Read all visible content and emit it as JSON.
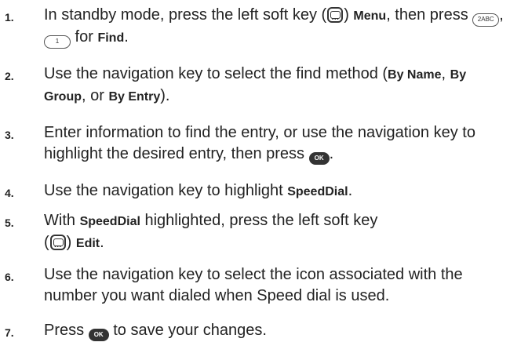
{
  "steps": [
    {
      "num": "1.",
      "t1": "In standby mode, press the left soft key (",
      "t2": ") ",
      "b1": "Menu",
      "t3": ", then press ",
      "key_a": "2ABC",
      "t4": ", ",
      "key_b": "1",
      "t5": " for ",
      "b2": "Find",
      "t6": "."
    },
    {
      "num": "2.",
      "t1": "Use the navigation key to select the find method (",
      "b1": "By Name",
      "t2": ", ",
      "b2": "By Group",
      "t3": ", or ",
      "b3": "By Entry",
      "t4": ")."
    },
    {
      "num": "3.",
      "t1": "Enter information to find the entry, or use the navigation key to highlight the desired entry, then press ",
      "ok": "OK",
      "t2": "."
    },
    {
      "num": "4.",
      "t1": "Use the navigation key to highlight ",
      "b1": "SpeedDial",
      "t2": "."
    },
    {
      "num": "5.",
      "t1": "With ",
      "b1": "SpeedDial",
      "t2": " highlighted, press the left soft key (",
      "t3": ") ",
      "b2": "Edit",
      "t4": "."
    },
    {
      "num": "6.",
      "t1": "Use the navigation key to select the icon associated with the number you want dialed when Speed dial is used."
    },
    {
      "num": "7.",
      "t1": "Press ",
      "ok": "OK",
      "t2": " to save your changes."
    }
  ],
  "icons": {
    "soft_key": "left-soft-key-icon",
    "num_key_2": "2abc-key-icon",
    "num_key_1": "1-key-icon",
    "ok_key": "ok-key-icon"
  }
}
